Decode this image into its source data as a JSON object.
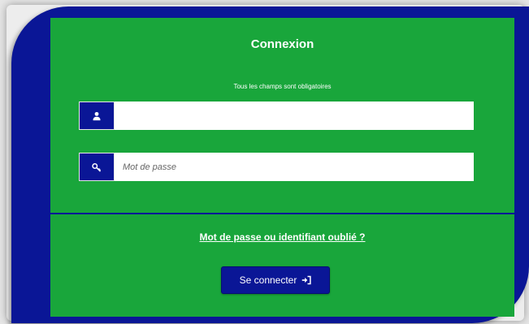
{
  "login": {
    "title": "Connexion",
    "subtitle": "Tous les champs sont obligatoires",
    "username": {
      "value": "",
      "placeholder": "",
      "icon": "user-icon"
    },
    "password": {
      "value": "",
      "placeholder": "Mot de passe",
      "icon": "key-icon"
    },
    "forgot_link": "Mot de passe ou identifiant oublié ?",
    "submit_label": "Se connecter",
    "submit_icon": "sign-in-icon"
  },
  "colors": {
    "panel_green": "#19a63b",
    "navy": "#0a1696",
    "background": "#e6e6e6"
  }
}
